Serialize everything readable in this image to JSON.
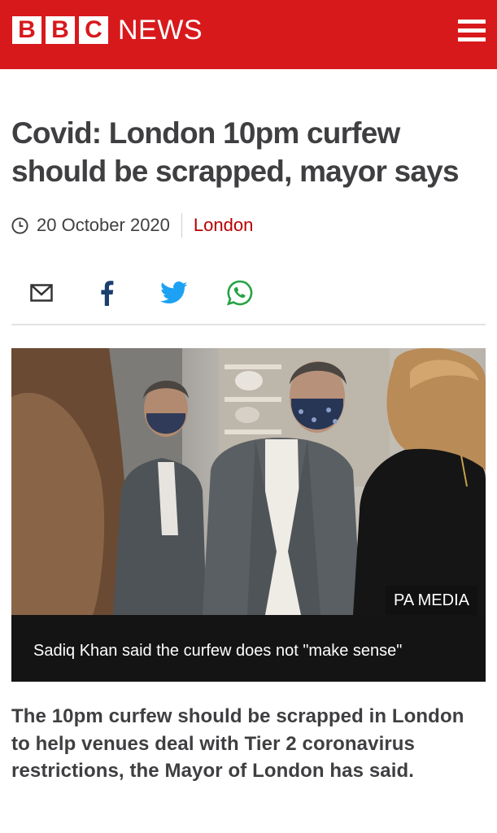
{
  "brand": {
    "logo_letters": [
      "B",
      "B",
      "C"
    ],
    "name": "NEWS",
    "color": "#d8191c",
    "menu_icon": "hamburger-menu-icon"
  },
  "article": {
    "headline": "Covid: London 10pm curfew should be scrapped, mayor says",
    "date": "20 October 2020",
    "topic": "London",
    "topic_color": "#b80000",
    "share": [
      "email-icon",
      "facebook-icon",
      "twitter-icon",
      "whatsapp-icon"
    ],
    "image": {
      "credit": "PA MEDIA",
      "caption": "Sadiq Khan said the curfew does not \"make sense\""
    },
    "intro": "The 10pm curfew should be scrapped in London to help venues deal with Tier 2 coronavirus restrictions, the Mayor of London has said."
  }
}
